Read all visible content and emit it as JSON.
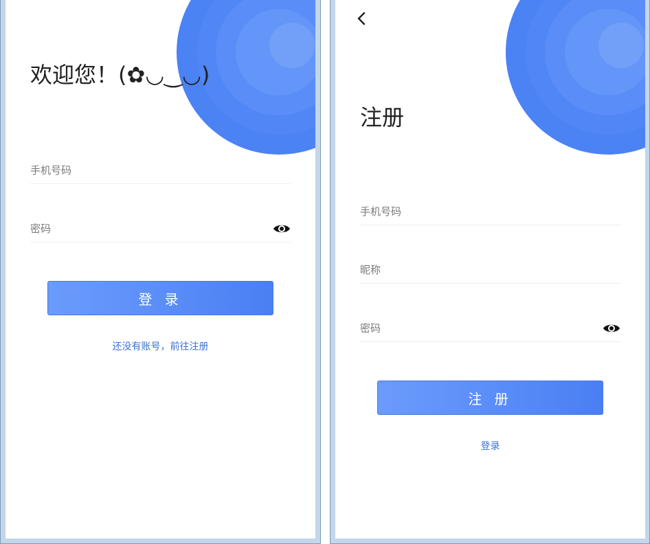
{
  "login": {
    "title": "欢迎您！(✿◡‿◡)",
    "phone_placeholder": "手机号码",
    "password_placeholder": "密码",
    "submit_label": "登 录",
    "register_link": "还没有账号，前往注册"
  },
  "register": {
    "title": "注册",
    "phone_placeholder": "手机号码",
    "nickname_placeholder": "昵称",
    "password_placeholder": "密码",
    "submit_label": "注 册",
    "login_link": "登录"
  },
  "icons": {
    "eye": "eye-icon",
    "back": "chevron-left-icon"
  },
  "colors": {
    "accent": "#5b8ef8",
    "link": "#3a72d8"
  }
}
